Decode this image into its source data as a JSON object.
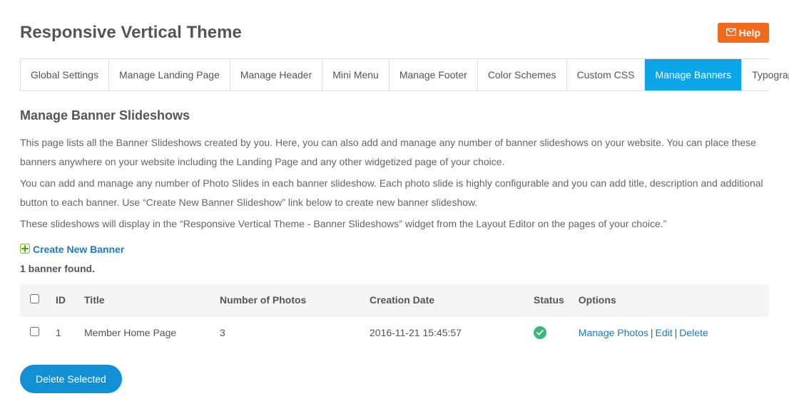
{
  "header": {
    "title": "Responsive Vertical Theme",
    "help_label": "Help"
  },
  "tabs": [
    {
      "label": "Global Settings"
    },
    {
      "label": "Manage Landing Page"
    },
    {
      "label": "Manage Header"
    },
    {
      "label": "Mini Menu"
    },
    {
      "label": "Manage Footer"
    },
    {
      "label": "Color Schemes"
    },
    {
      "label": "Custom CSS"
    },
    {
      "label": "Manage Banners",
      "active": true
    },
    {
      "label": "Typography"
    }
  ],
  "section": {
    "title": "Manage Banner Slideshows",
    "desc1": "This page lists all the Banner Slideshows created by you. Here, you can also add and manage any number of banner slideshows on your website. You can place these banners anywhere on your website including the Landing Page and any other widgetized page of your choice.",
    "desc2": "You can add and manage any number of Photo Slides in each banner slideshow. Each photo slide is highly configurable and you can add title, description and additional button to each banner. Use “Create New Banner Slideshow” link below to create new banner slideshow.",
    "desc3": "These slideshows will display in the “Responsive Vertical Theme - Banner Slideshows” widget from the Layout Editor on the pages of your choice.”"
  },
  "create_link": "Create New Banner",
  "found_text": "1 banner found.",
  "table": {
    "headers": {
      "id": "ID",
      "title": "Title",
      "photos": "Number of Photos",
      "date": "Creation Date",
      "status": "Status",
      "options": "Options"
    },
    "row": {
      "id": "1",
      "title": "Member Home Page",
      "photos": "3",
      "date": "2016-11-21 15:45:57"
    },
    "options": {
      "manage": "Manage Photos",
      "edit": "Edit",
      "delete": "Delete"
    }
  },
  "delete_selected": "Delete Selected"
}
